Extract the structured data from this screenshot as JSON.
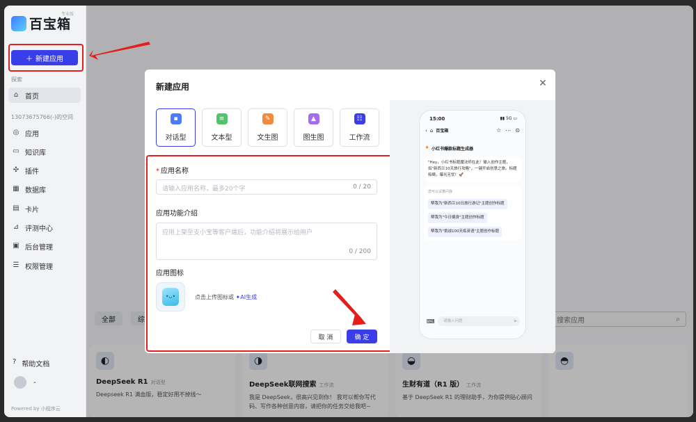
{
  "sidebar": {
    "logo_text": "百宝箱",
    "edition": "专业版",
    "new_app_label": "新建应用",
    "explore_label": "探索",
    "home_label": "首页",
    "workspace_label": "13073675766(-)的空间",
    "items": [
      {
        "label": "应用",
        "icon": "app-icon"
      },
      {
        "label": "知识库",
        "icon": "folder-icon"
      },
      {
        "label": "插件",
        "icon": "plugin-icon"
      },
      {
        "label": "数据库",
        "icon": "database-icon"
      },
      {
        "label": "卡片",
        "icon": "card-icon"
      },
      {
        "label": "评测中心",
        "icon": "chart-icon"
      },
      {
        "label": "后台管理",
        "icon": "admin-icon"
      },
      {
        "label": "权限管理",
        "icon": "permission-icon"
      }
    ],
    "help_label": "帮助文档",
    "user_label": "-",
    "powered": "Powered by 小程序云"
  },
  "background": {
    "filter_all": "全部",
    "filter_partial": "综",
    "search_placeholder": "搜索应用",
    "cards": [
      {
        "title": "DeepSeek R1",
        "tag": "对话型",
        "desc": "Deepseek R1 满血版，稳定好用不掉线～"
      },
      {
        "title": "DeepSeek联网搜索",
        "tag": "工作流",
        "desc": "我是 DeepSeek，很高兴见到你！ 我可以帮你写代码、写作各种创意内容，请把你的任务交给我吧~"
      },
      {
        "title": "生财有道（R1 版）",
        "tag": "工作流",
        "desc": "基于 DeepSeek R1 的理财助手，为你提供贴心顾问"
      }
    ]
  },
  "modal": {
    "title": "新建应用",
    "types": [
      {
        "label": "对话型",
        "color": "#4a7cff"
      },
      {
        "label": "文本型",
        "color": "#51c46a"
      },
      {
        "label": "文生图",
        "color": "#f08a3c"
      },
      {
        "label": "图生图",
        "color": "#a56cf0"
      },
      {
        "label": "工作流",
        "color": "#3a3ee8"
      }
    ],
    "name_label": "应用名称",
    "name_placeholder": "请输入应用名称，最多20个字",
    "name_count": "0 / 20",
    "desc_label": "应用功能介绍",
    "desc_placeholder": "应用上架至支小宝等客户端后，功能介绍将展示给用户",
    "desc_count": "0 / 200",
    "icon_label": "应用图标",
    "upload_text": "点击上传图标或",
    "ai_text": "✦AI生成",
    "cancel": "取 消",
    "ok": "确 定"
  },
  "preview": {
    "time": "15:00",
    "signal": "5G",
    "app_name": "百宝箱",
    "bot_name": "小红书爆款标题生成器",
    "greeting": "\"Hey，小红书标题魔法师在此！输入创作主题，如\"新西兰10天旅行攻略\"，一键开启创意之旅。标题吸睛，曝光无忧！🚀",
    "suggest_title": "您可以试着问我",
    "suggestions": [
      "帮我为\"新西兰10日旅行游记\"主题创作标题",
      "帮我为\"今日健身\"主题创作标题",
      "帮我为\"挑战100天练英语\"主题创作标题"
    ],
    "input_placeholder": "请输入问题"
  }
}
